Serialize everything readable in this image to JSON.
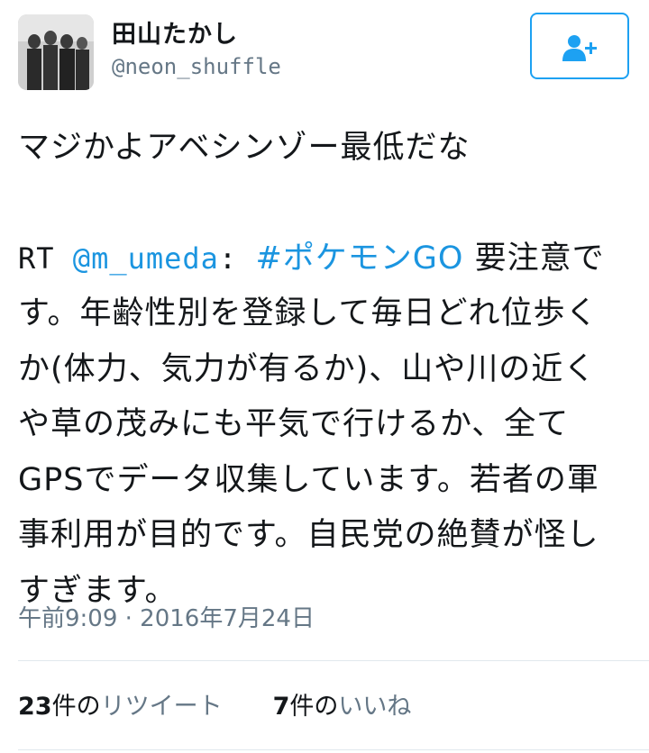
{
  "user": {
    "display_name": "田山たかし",
    "handle": "@neon_shuffle"
  },
  "follow_button": {
    "icon": "add-user-icon",
    "color": "#1da1f2"
  },
  "tweet": {
    "line_intro": "マジかよアベシンゾー最低だな",
    "rt_prefix": "RT ",
    "mention": "@m_umeda",
    "colon": ": ",
    "hashtag": "#ポケモンGO",
    "body": " 要注意です。年齢性別を登録して毎日どれ位歩くか(体力、気力が有るか)、山や川の近くや草の茂みにも平気で行けるか、全てGPSでデータ収集しています。若者の軍事利用が目的です。自民党の絶賛が怪しすぎます。"
  },
  "timestamp": "午前9:09 · 2016年7月24日",
  "stats": {
    "retweets_count": "23",
    "retweets_unit": "件の",
    "retweets_label": "リツイート",
    "likes_count": "7",
    "likes_unit": "件の",
    "likes_label": "いいね"
  },
  "colors": {
    "link": "#1b95e0",
    "secondary_text": "#657786",
    "text": "#14171a"
  }
}
